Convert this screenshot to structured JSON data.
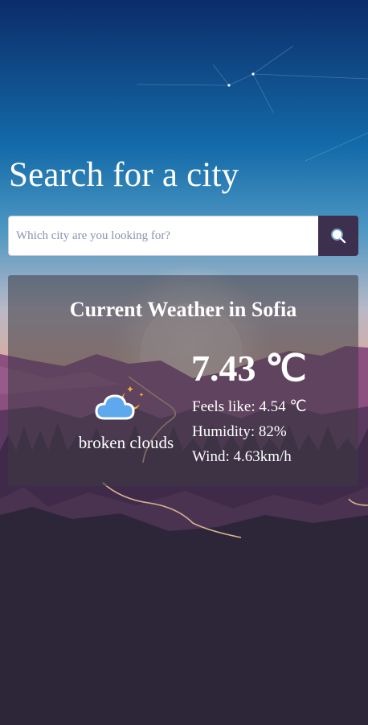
{
  "page": {
    "title": "Search for a city"
  },
  "search": {
    "placeholder": "Which city are you looking for?",
    "value": "",
    "button_icon": "search-icon"
  },
  "weather": {
    "heading": "Current Weather in Sofia",
    "temperature": "7.43 ℃",
    "feels_like": "Feels like: 4.54 ℃",
    "humidity": "Humidity: 82%",
    "wind": "Wind: 4.63km/h",
    "description": "broken clouds",
    "icon": "cloud-moon-icon"
  },
  "colors": {
    "sky_top": "#0c2f6b",
    "sky_mid": "#1a6aa5",
    "sky_horizon": "#e4a38f",
    "mountain_back": "#8c4f80",
    "mountain_mid": "#5b3860",
    "ground": "#2d2639",
    "button_bg": "#3d2f4e",
    "cloud": "#5ea8ee",
    "moon": "#f6b23a"
  }
}
